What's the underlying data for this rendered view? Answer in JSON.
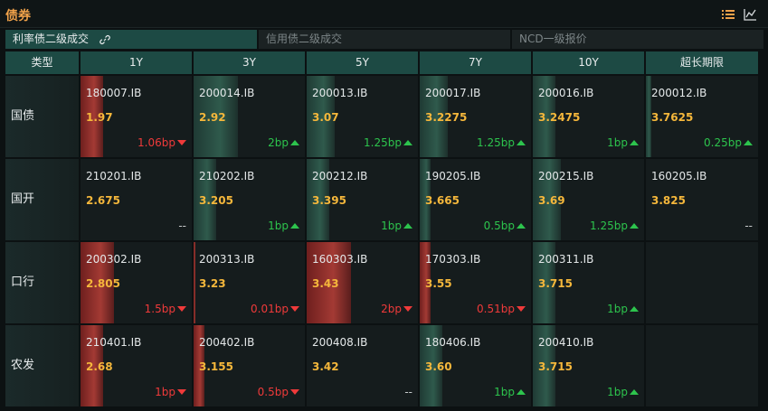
{
  "header": {
    "title": "债券",
    "icons": [
      "list-icon",
      "chart-icon"
    ]
  },
  "tabs": [
    {
      "label": "利率债二级成交",
      "active": true
    },
    {
      "label": "信用债二级成交",
      "active": false
    },
    {
      "label": "NCD一级报价",
      "active": false
    }
  ],
  "columns": [
    "类型",
    "1Y",
    "3Y",
    "5Y",
    "7Y",
    "10Y",
    "超长期限"
  ],
  "rows": [
    {
      "label": "国债",
      "cells": [
        {
          "code": "180007.IB",
          "yield": "1.97",
          "change": "1.06bp",
          "dir": "down",
          "bar": 0.2
        },
        {
          "code": "200014.IB",
          "yield": "2.92",
          "change": "2bp",
          "dir": "up",
          "bar": 0.4
        },
        {
          "code": "200013.IB",
          "yield": "3.07",
          "change": "1.25bp",
          "dir": "up",
          "bar": 0.25
        },
        {
          "code": "200017.IB",
          "yield": "3.2275",
          "change": "1.25bp",
          "dir": "up",
          "bar": 0.25
        },
        {
          "code": "200016.IB",
          "yield": "3.2475",
          "change": "1bp",
          "dir": "up",
          "bar": 0.2
        },
        {
          "code": "200012.IB",
          "yield": "3.7625",
          "change": "0.25bp",
          "dir": "up",
          "bar": 0.05
        }
      ]
    },
    {
      "label": "国开",
      "cells": [
        {
          "code": "210201.IB",
          "yield": "2.675",
          "change": "--",
          "dir": "none",
          "bar": 0
        },
        {
          "code": "210202.IB",
          "yield": "3.205",
          "change": "1bp",
          "dir": "up",
          "bar": 0.2
        },
        {
          "code": "200212.IB",
          "yield": "3.395",
          "change": "1bp",
          "dir": "up",
          "bar": 0.2
        },
        {
          "code": "190205.IB",
          "yield": "3.665",
          "change": "0.5bp",
          "dir": "up",
          "bar": 0.1
        },
        {
          "code": "200215.IB",
          "yield": "3.69",
          "change": "1.25bp",
          "dir": "up",
          "bar": 0.25
        },
        {
          "code": "160205.IB",
          "yield": "3.825",
          "change": "--",
          "dir": "none",
          "bar": 0
        }
      ]
    },
    {
      "label": "口行",
      "cells": [
        {
          "code": "200302.IB",
          "yield": "2.805",
          "change": "1.5bp",
          "dir": "down",
          "bar": 0.3
        },
        {
          "code": "200313.IB",
          "yield": "3.23",
          "change": "0.01bp",
          "dir": "down",
          "bar": 0.02
        },
        {
          "code": "160303.IB",
          "yield": "3.43",
          "change": "2bp",
          "dir": "down",
          "bar": 0.4
        },
        {
          "code": "170303.IB",
          "yield": "3.55",
          "change": "0.51bp",
          "dir": "down",
          "bar": 0.1
        },
        {
          "code": "200311.IB",
          "yield": "3.715",
          "change": "1bp",
          "dir": "up",
          "bar": 0.2
        },
        {
          "code": "",
          "yield": "",
          "change": "",
          "dir": "empty",
          "bar": 0
        }
      ]
    },
    {
      "label": "农发",
      "cells": [
        {
          "code": "210401.IB",
          "yield": "2.68",
          "change": "1bp",
          "dir": "down",
          "bar": 0.2
        },
        {
          "code": "200402.IB",
          "yield": "3.155",
          "change": "0.5bp",
          "dir": "down",
          "bar": 0.1
        },
        {
          "code": "200408.IB",
          "yield": "3.42",
          "change": "--",
          "dir": "none",
          "bar": 0
        },
        {
          "code": "180406.IB",
          "yield": "3.60",
          "change": "1bp",
          "dir": "up",
          "bar": 0.2
        },
        {
          "code": "200410.IB",
          "yield": "3.715",
          "change": "1bp",
          "dir": "up",
          "bar": 0.2
        },
        {
          "code": "",
          "yield": "",
          "change": "",
          "dir": "empty",
          "bar": 0
        }
      ]
    }
  ],
  "colors": {
    "accent": "#f0a24a",
    "header_bg": "#1d4a44",
    "yield": "#f5b73b",
    "down": "#ef3a3a",
    "up": "#2dc44d"
  }
}
